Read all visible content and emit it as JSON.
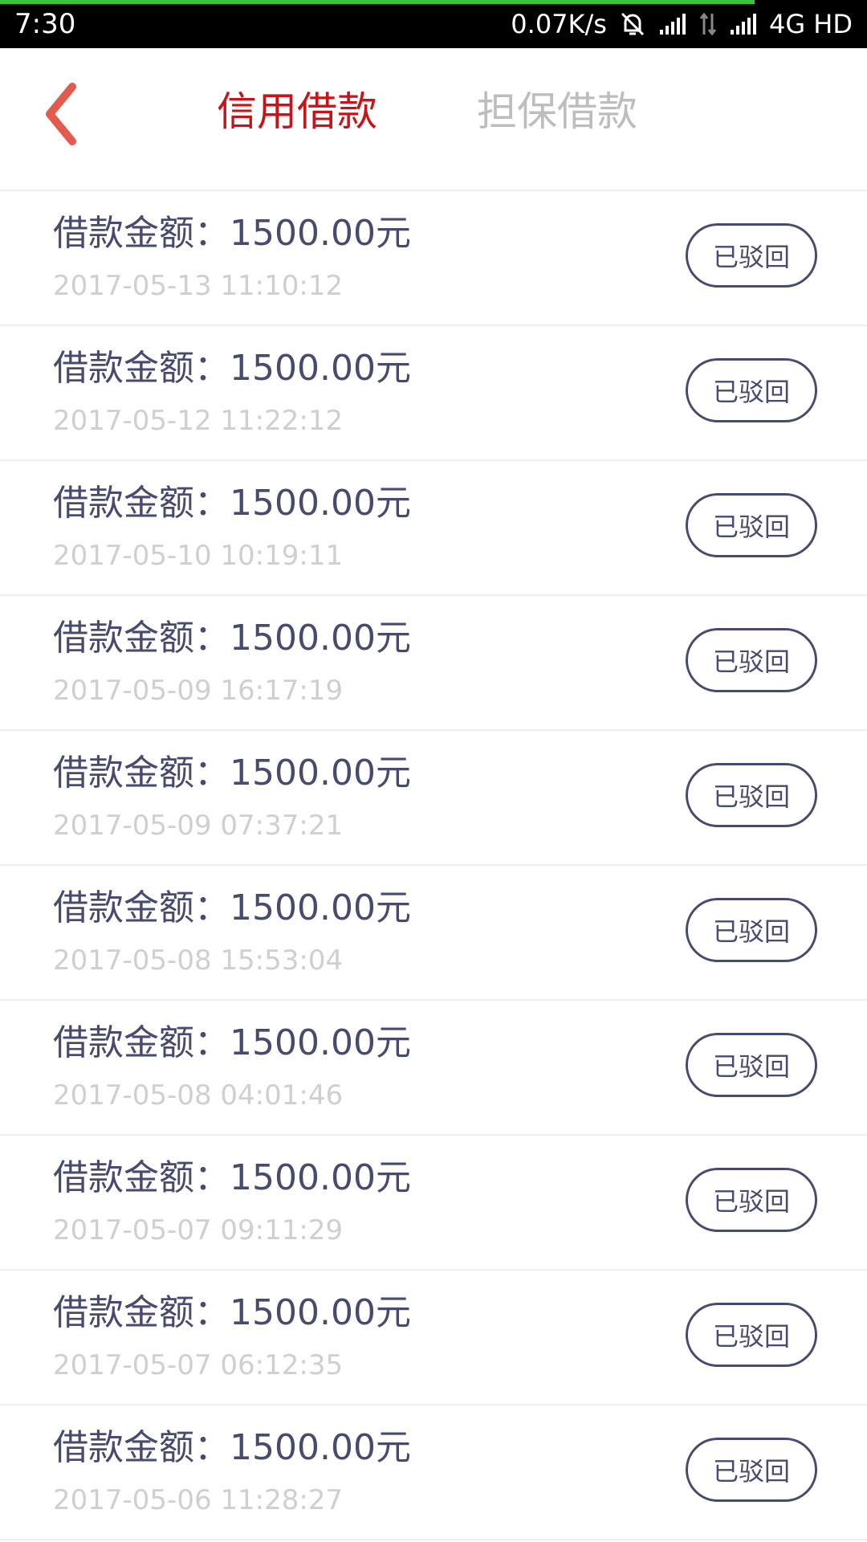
{
  "status_bar": {
    "time": "7:30",
    "speed": "0.07K/s",
    "network": "4G HD",
    "icons": [
      "mute-bell-icon",
      "signal-icon",
      "data-arrows-icon",
      "signal-icon"
    ],
    "page_load_progress": 0.87
  },
  "header": {
    "back_icon": "chevron-left-icon",
    "tabs": [
      {
        "label": "信用借款",
        "active": true
      },
      {
        "label": "担保借款",
        "active": false
      }
    ],
    "colors": {
      "active": "#c81418",
      "inactive": "#bdbdbd",
      "back": "#e35a4e"
    }
  },
  "loans": [
    {
      "title": "借款金额：1500.00元",
      "time": "2017-05-13 11:10:12",
      "status": "已驳回"
    },
    {
      "title": "借款金额：1500.00元",
      "time": "2017-05-12 11:22:12",
      "status": "已驳回"
    },
    {
      "title": "借款金额：1500.00元",
      "time": "2017-05-10 10:19:11",
      "status": "已驳回"
    },
    {
      "title": "借款金额：1500.00元",
      "time": "2017-05-09 16:17:19",
      "status": "已驳回"
    },
    {
      "title": "借款金额：1500.00元",
      "time": "2017-05-09 07:37:21",
      "status": "已驳回"
    },
    {
      "title": "借款金额：1500.00元",
      "time": "2017-05-08 15:53:04",
      "status": "已驳回"
    },
    {
      "title": "借款金额：1500.00元",
      "time": "2017-05-08 04:01:46",
      "status": "已驳回"
    },
    {
      "title": "借款金额：1500.00元",
      "time": "2017-05-07 09:11:29",
      "status": "已驳回"
    },
    {
      "title": "借款金额：1500.00元",
      "time": "2017-05-07 06:12:35",
      "status": "已驳回"
    },
    {
      "title": "借款金额：1500.00元",
      "time": "2017-05-06 11:28:27",
      "status": "已驳回"
    }
  ],
  "colors": {
    "title_text": "#474c6f",
    "time_text": "#cfcfcf",
    "status_border": "#474c6f",
    "divider": "#eeeeee"
  }
}
